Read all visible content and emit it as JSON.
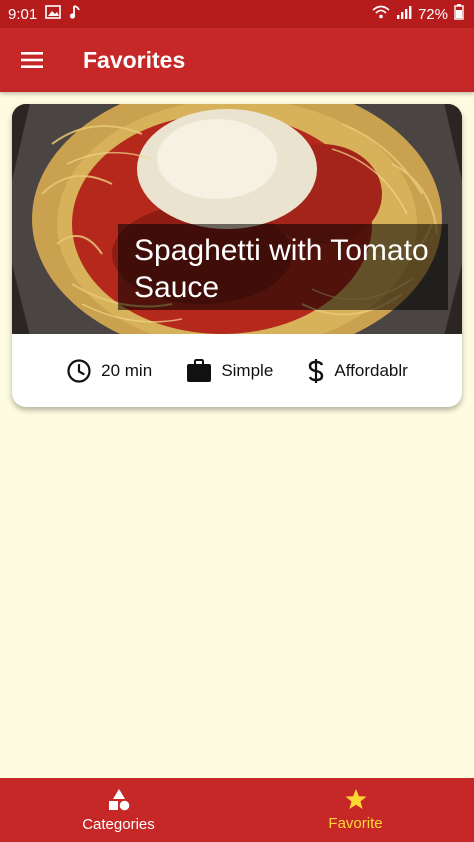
{
  "status_bar": {
    "time": "9:01",
    "battery": "72%",
    "icons": [
      "image-icon",
      "music-icon",
      "wifi-icon",
      "signal-icon",
      "battery-icon"
    ]
  },
  "app_bar": {
    "title": "Favorites",
    "menu_icon": "hamburger-icon"
  },
  "meal_card": {
    "title": "Spaghetti with Tomato Sauce",
    "duration": "20 min",
    "complexity": "Simple",
    "affordability": "Affordablr",
    "icons": [
      "clock-icon",
      "briefcase-icon",
      "dollar-icon"
    ]
  },
  "bottom_nav": {
    "items": [
      {
        "label": "Categories",
        "icon": "category-icon",
        "active": false
      },
      {
        "label": "Favorite",
        "icon": "star-icon",
        "active": true
      }
    ]
  },
  "colors": {
    "primary": "#c62828",
    "status_bar": "#b71c1c",
    "accent": "#fdd835",
    "background": "#fefce0"
  }
}
